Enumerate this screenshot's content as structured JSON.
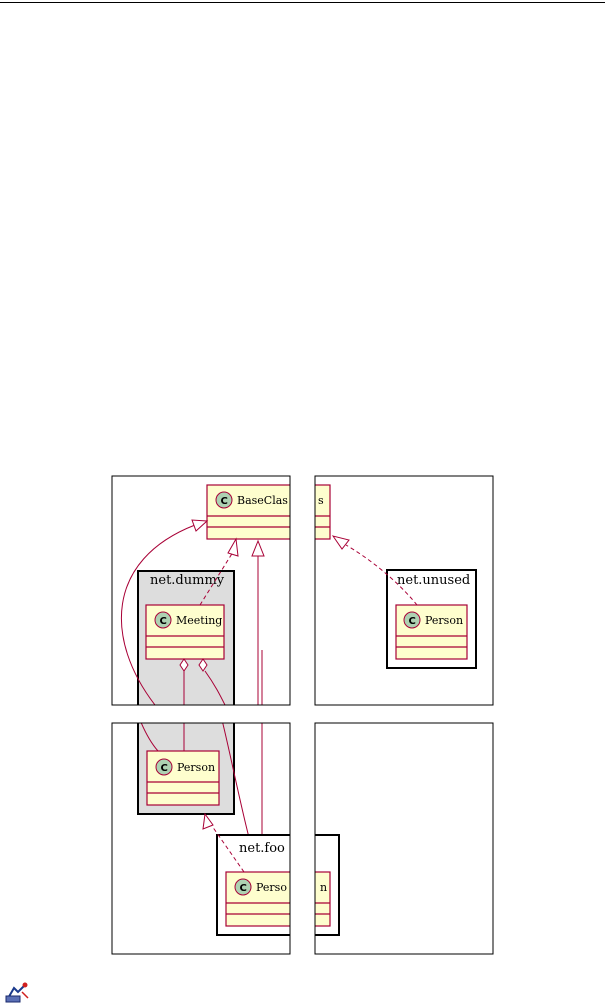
{
  "colors": {
    "class_fill": "#FEFECE",
    "class_border": "#A80036",
    "circle_fill": "#ADD1B2",
    "package_dummy_fill": "#DDDDDD",
    "package_border": "#000000"
  },
  "packages": {
    "dummy": "net.dummy",
    "unused": "net.unused",
    "foo": "net.foo"
  },
  "classes": {
    "base_class": "BaseClas",
    "base_class_tail": "s",
    "meeting": "Meeting",
    "person_unused": "Person",
    "person_dummy": "Person",
    "person_foo_head": "Perso",
    "person_foo_tail": "n"
  },
  "class_marker": "C"
}
